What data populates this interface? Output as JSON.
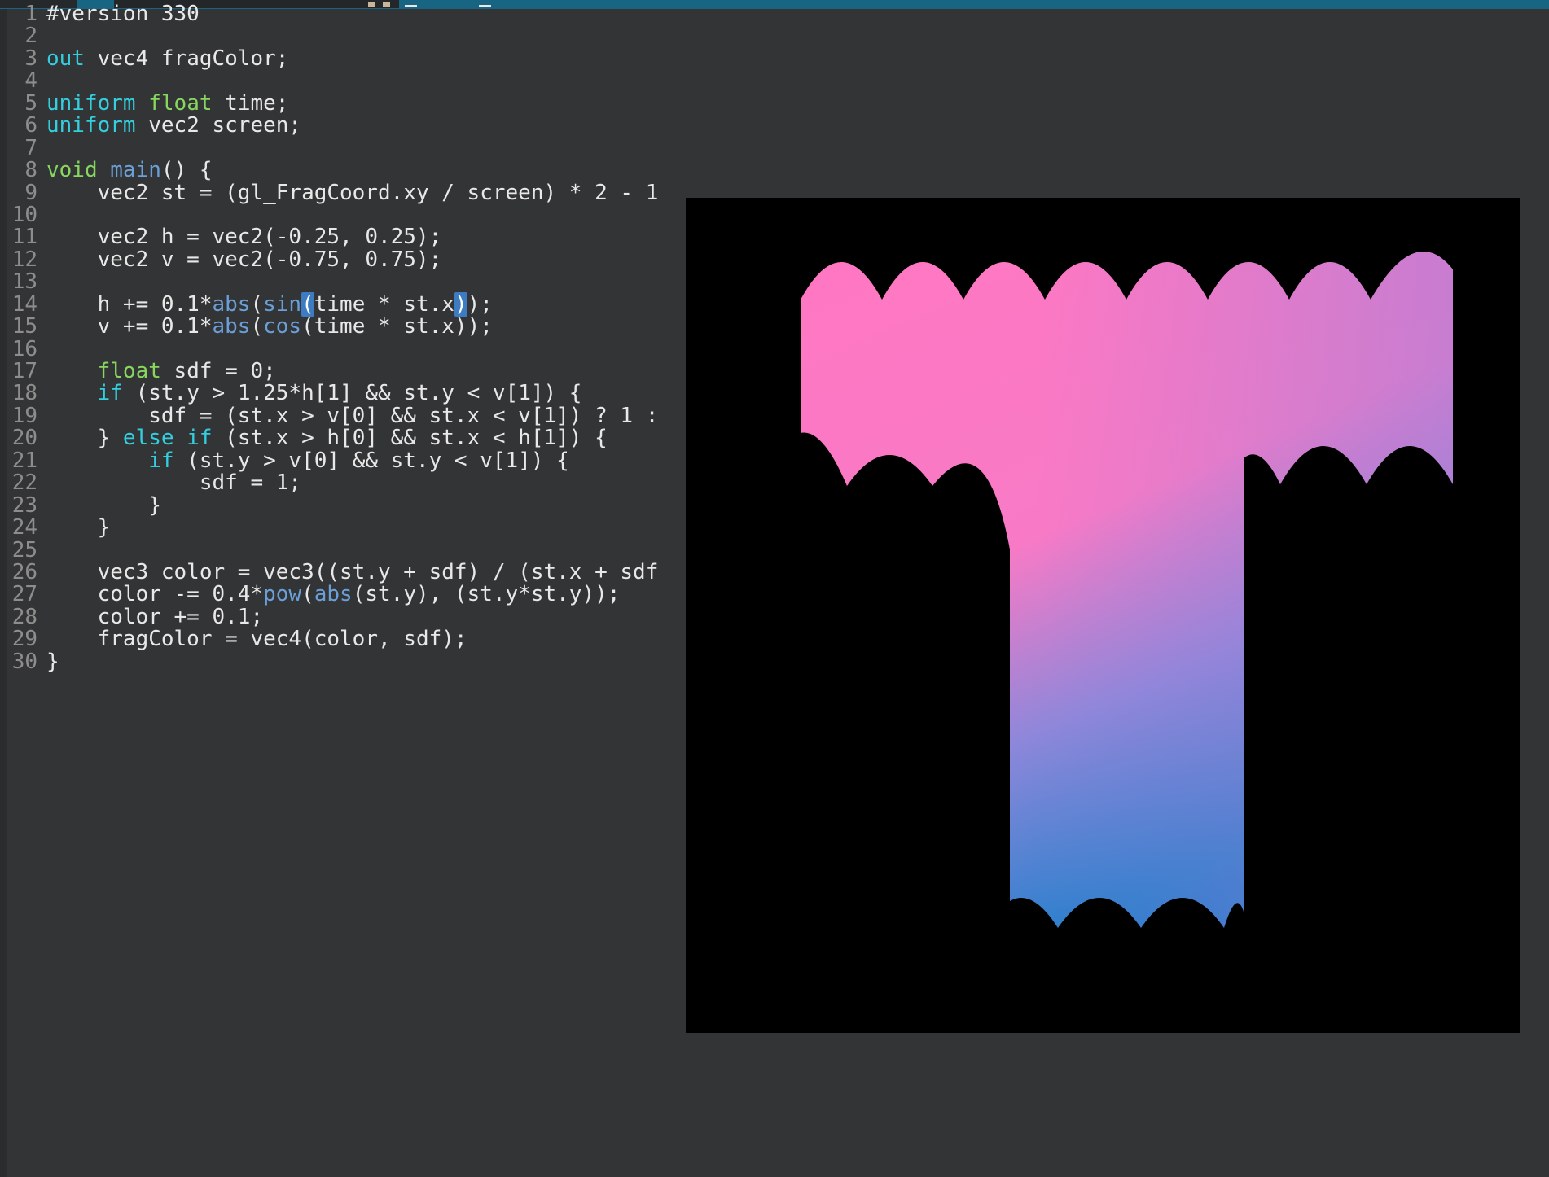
{
  "window": {
    "titlebar": {
      "accent_color": "#186583",
      "tab_color": "#242729",
      "left_block_color": "#26292c",
      "note": "title bar cropped; only glyph fragments visible"
    }
  },
  "editor": {
    "background": "#333435",
    "gutter_color": "#8d8d8d",
    "syntax_colors": {
      "plain": "#e8e8e8",
      "keyword": "#33cfe0",
      "type": "#87d65f",
      "function": "#6b9fd8",
      "paren_match_bg": "#3d7cc2"
    },
    "lines": [
      {
        "n": "1",
        "tokens": [
          [
            "p",
            "#version 330"
          ]
        ]
      },
      {
        "n": "2",
        "tokens": []
      },
      {
        "n": "3",
        "tokens": [
          [
            "k",
            "out"
          ],
          [
            "p",
            " vec4 fragColor;"
          ]
        ]
      },
      {
        "n": "4",
        "tokens": []
      },
      {
        "n": "5",
        "tokens": [
          [
            "k",
            "uniform"
          ],
          [
            "p",
            " "
          ],
          [
            "t",
            "float"
          ],
          [
            "p",
            " time;"
          ]
        ]
      },
      {
        "n": "6",
        "tokens": [
          [
            "k",
            "uniform"
          ],
          [
            "p",
            " vec2 screen;"
          ]
        ]
      },
      {
        "n": "7",
        "tokens": []
      },
      {
        "n": "8",
        "tokens": [
          [
            "t",
            "void"
          ],
          [
            "p",
            " "
          ],
          [
            "f",
            "main"
          ],
          [
            "p",
            "() {"
          ]
        ]
      },
      {
        "n": "9",
        "tokens": [
          [
            "p",
            "    vec2 st = (gl_FragCoord.xy / screen) * 2 - 1"
          ]
        ]
      },
      {
        "n": "10",
        "tokens": []
      },
      {
        "n": "11",
        "tokens": [
          [
            "p",
            "    vec2 h = vec2(-0.25, 0.25);"
          ]
        ]
      },
      {
        "n": "12",
        "tokens": [
          [
            "p",
            "    vec2 v = vec2(-0.75, 0.75);"
          ]
        ]
      },
      {
        "n": "13",
        "tokens": []
      },
      {
        "n": "14",
        "tokens": [
          [
            "p",
            "    h += 0.1*"
          ],
          [
            "f",
            "abs"
          ],
          [
            "p",
            "("
          ],
          [
            "f",
            "sin"
          ],
          [
            "hl",
            "("
          ],
          [
            "p",
            "time * st.x"
          ],
          [
            "hl",
            ")"
          ],
          [
            "p",
            ");"
          ]
        ]
      },
      {
        "n": "15",
        "tokens": [
          [
            "p",
            "    v += 0.1*"
          ],
          [
            "f",
            "abs"
          ],
          [
            "p",
            "("
          ],
          [
            "f",
            "cos"
          ],
          [
            "p",
            "(time * st.x));"
          ]
        ]
      },
      {
        "n": "16",
        "tokens": []
      },
      {
        "n": "17",
        "tokens": [
          [
            "p",
            "    "
          ],
          [
            "t",
            "float"
          ],
          [
            "p",
            " sdf = 0;"
          ]
        ]
      },
      {
        "n": "18",
        "tokens": [
          [
            "p",
            "    "
          ],
          [
            "k",
            "if"
          ],
          [
            "p",
            " (st.y > 1.25*h[1] && st.y < v[1]) {"
          ]
        ]
      },
      {
        "n": "19",
        "tokens": [
          [
            "p",
            "        sdf = (st.x > v[0] && st.x < v[1]) ? 1 :"
          ]
        ]
      },
      {
        "n": "20",
        "tokens": [
          [
            "p",
            "    } "
          ],
          [
            "k",
            "else"
          ],
          [
            "p",
            " "
          ],
          [
            "k",
            "if"
          ],
          [
            "p",
            " (st.x > h[0] && st.x < h[1]) {"
          ]
        ]
      },
      {
        "n": "21",
        "tokens": [
          [
            "p",
            "        "
          ],
          [
            "k",
            "if"
          ],
          [
            "p",
            " (st.y > v[0] && st.y < v[1]) {"
          ]
        ]
      },
      {
        "n": "22",
        "tokens": [
          [
            "p",
            "            sdf = 1;"
          ]
        ]
      },
      {
        "n": "23",
        "tokens": [
          [
            "p",
            "        }"
          ]
        ]
      },
      {
        "n": "24",
        "tokens": [
          [
            "p",
            "    }"
          ]
        ]
      },
      {
        "n": "25",
        "tokens": []
      },
      {
        "n": "26",
        "tokens": [
          [
            "p",
            "    vec3 color = vec3((st.y + sdf) / (st.x + sdf"
          ]
        ]
      },
      {
        "n": "27",
        "tokens": [
          [
            "p",
            "    color -= 0.4*"
          ],
          [
            "f",
            "pow"
          ],
          [
            "p",
            "("
          ],
          [
            "f",
            "abs"
          ],
          [
            "p",
            "(st.y), (st.y*st.y));"
          ]
        ]
      },
      {
        "n": "28",
        "tokens": [
          [
            "p",
            "    color += 0.1;"
          ]
        ]
      },
      {
        "n": "29",
        "tokens": [
          [
            "p",
            "    fragColor = vec4(color, sdf);"
          ]
        ]
      },
      {
        "n": "30",
        "tokens": [
          [
            "p",
            "}"
          ]
        ]
      }
    ]
  },
  "shader_preview": {
    "background": "#000000",
    "shape": "letter-T-with-scalloped-edges",
    "gradient": {
      "pink_top": "#ff77c2",
      "pink_mid": "#f87ac6",
      "purple_mid": "#8e87da",
      "blue_deep": "#2c80cd",
      "blue_bottom": "#1878ca",
      "overlay_purple": "#a77fd8"
    }
  }
}
